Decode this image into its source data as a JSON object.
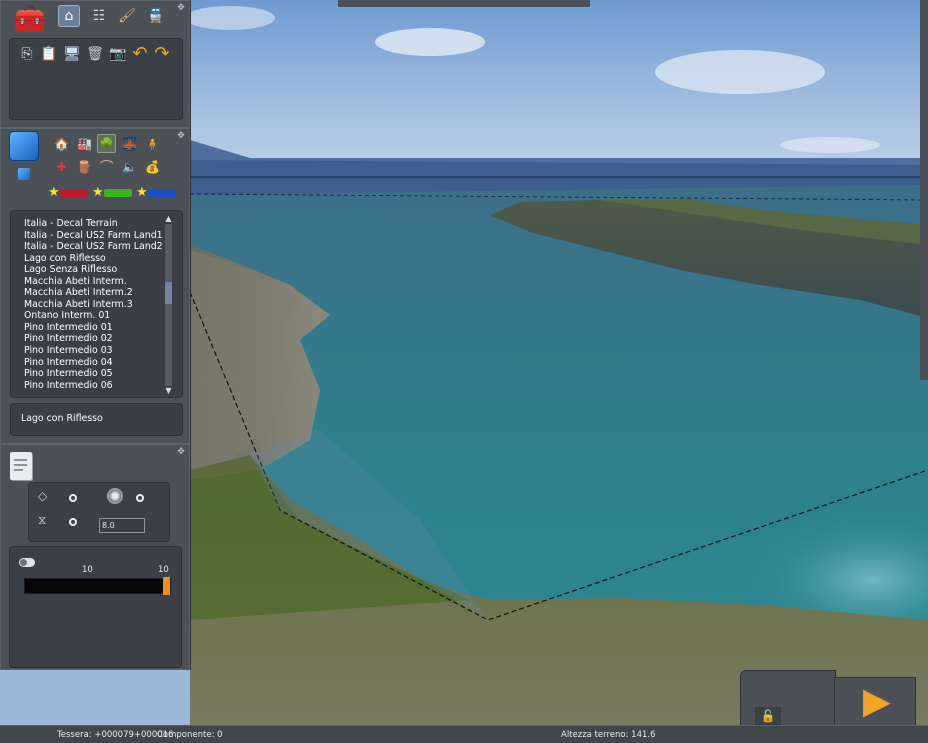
{
  "main_toolbar": {
    "tabs": [
      {
        "name": "toolbox-icon",
        "glyph": "🧰"
      },
      {
        "name": "home-icon",
        "glyph": "⌂"
      },
      {
        "name": "track-icon",
        "glyph": "☷"
      },
      {
        "name": "paintbrush-icon",
        "glyph": "🖌"
      },
      {
        "name": "train-icon",
        "glyph": "🚆"
      }
    ],
    "actions": [
      {
        "name": "copy-icon",
        "glyph": "⎘"
      },
      {
        "name": "paste-icon",
        "glyph": "📋"
      },
      {
        "name": "monitor-icon",
        "glyph": "🖥"
      },
      {
        "name": "trash-icon",
        "glyph": "🗑"
      },
      {
        "name": "camera-icon",
        "glyph": "📷"
      },
      {
        "name": "undo-icon",
        "glyph": "↶"
      },
      {
        "name": "redo-icon",
        "glyph": "↷"
      }
    ]
  },
  "object_panel": {
    "categories_row1": [
      {
        "name": "building-icon",
        "glyph": "🏠"
      },
      {
        "name": "industry-icon",
        "glyph": "🏭"
      },
      {
        "name": "tree-icon",
        "glyph": "🌳"
      },
      {
        "name": "bridge-icon",
        "glyph": "🌉"
      },
      {
        "name": "figure-icon",
        "glyph": "🧍"
      }
    ],
    "categories_row2": [
      {
        "name": "crossing-icon",
        "glyph": "✚"
      },
      {
        "name": "timber-icon",
        "glyph": "🪵"
      },
      {
        "name": "arch-icon",
        "glyph": "⌒"
      },
      {
        "name": "speaker-icon",
        "glyph": "🔈"
      },
      {
        "name": "bag-icon",
        "glyph": "💰"
      }
    ],
    "filter_colors": [
      "#c0192b",
      "#39b51c",
      "#1c4fc5"
    ]
  },
  "asset_list": {
    "items": [
      "Italia - Decal Terrain",
      "Italia - Decal US2 Farm Land1",
      "Italia - Decal US2 Farm Land2",
      "Lago con Riflesso",
      "Lago Senza Riflesso",
      "Macchia Abeti Interm.",
      "Macchia Abeti Interm.2",
      "Macchia Abeti Interm.3",
      "Ontano Interm. 01",
      "Pino Intermedio 01",
      "Pino Intermedio 02",
      "Pino Intermedio 03",
      "Pino Intermedio 04",
      "Pino Intermedio 05",
      "Pino Intermedio 06"
    ],
    "selected": "Lago con Riflesso",
    "scroll_up": "▲",
    "scroll_down": "▼"
  },
  "properties_panel": {
    "height_value": "8.0",
    "slider_min_label": "10",
    "slider_max_label": "10",
    "slider_fraction": 1.0,
    "accent": "#f08c1a"
  },
  "statusbar": {
    "tile": "Tessera: +000079+000016",
    "component": "Componente: 0",
    "terrain_height": "Altezza terreno:  141.6"
  },
  "play_button": "▶",
  "lock_icon": "🔓"
}
